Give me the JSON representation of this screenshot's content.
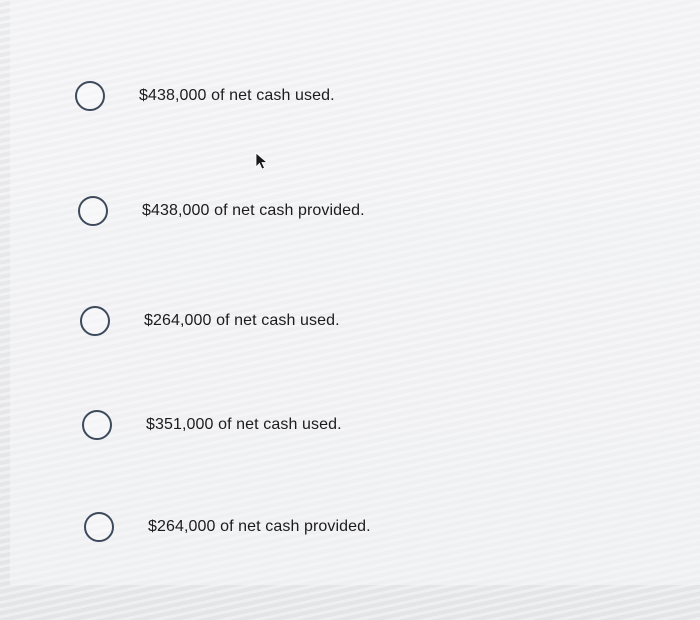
{
  "question": {
    "options": [
      {
        "label": "$438,000 of net cash used."
      },
      {
        "label": "$438,000 of net cash provided."
      },
      {
        "label": "$264,000 of net cash used."
      },
      {
        "label": "$351,000 of net cash used."
      },
      {
        "label": "$264,000 of net cash provided."
      }
    ]
  },
  "cursor": {
    "icon": "mouse-pointer-icon"
  }
}
